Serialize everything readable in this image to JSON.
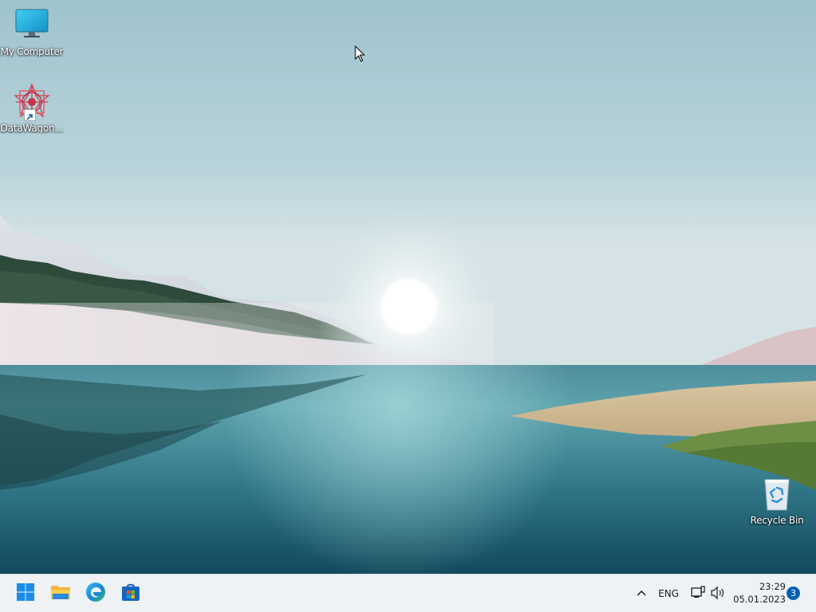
{
  "desktop": {
    "icons": [
      {
        "label": "My Computer"
      },
      {
        "label": "DataWagon..."
      },
      {
        "label": "Recycle Bin"
      }
    ]
  },
  "taskbar": {
    "pinned": [
      {
        "icon": "windows-start-icon"
      },
      {
        "icon": "file-explorer-icon"
      },
      {
        "icon": "edge-browser-icon"
      },
      {
        "icon": "microsoft-store-icon"
      }
    ],
    "tray": {
      "language": "ENG",
      "time": "23:29",
      "date": "05.01.2023",
      "notifications": "3"
    }
  },
  "colors": {
    "accent": "#0063b1",
    "taskbar_bg": "#eef2f5"
  }
}
